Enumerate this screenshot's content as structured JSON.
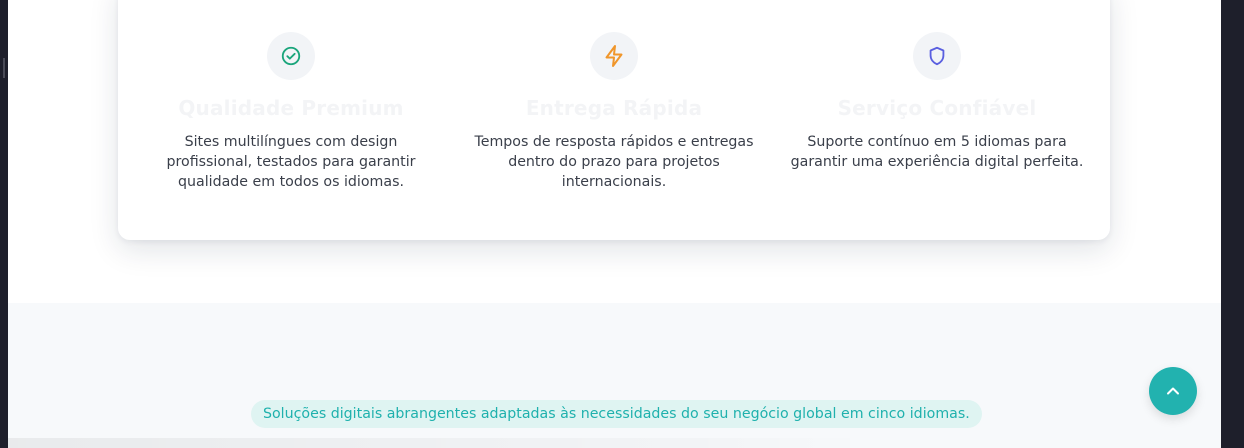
{
  "features": [
    {
      "title": "Qualidade Premium",
      "description": "Sites multilíngues com design profissional, testados para garantir qualidade em todos os idiomas.",
      "icon": "check-circle-icon",
      "icon_color": "#1aa57b"
    },
    {
      "title": "Entrega Rápida",
      "description": "Tempos de resposta rápidos e entregas dentro do prazo para projetos internacionais.",
      "icon": "lightning-bolt-icon",
      "icon_color": "#f0962b"
    },
    {
      "title": "Serviço Confiável",
      "description": "Suporte contínuo em 5 idiomas para garantir uma experiência digital perfeita.",
      "icon": "shield-icon",
      "icon_color": "#5a5fe0"
    }
  ],
  "section": {
    "tagline": "Soluções digitais abrangentes adaptadas às necessidades do seu negócio global em cinco idiomas."
  },
  "back_to_top": {
    "icon": "chevron-up-icon",
    "color": "#22b2af"
  }
}
